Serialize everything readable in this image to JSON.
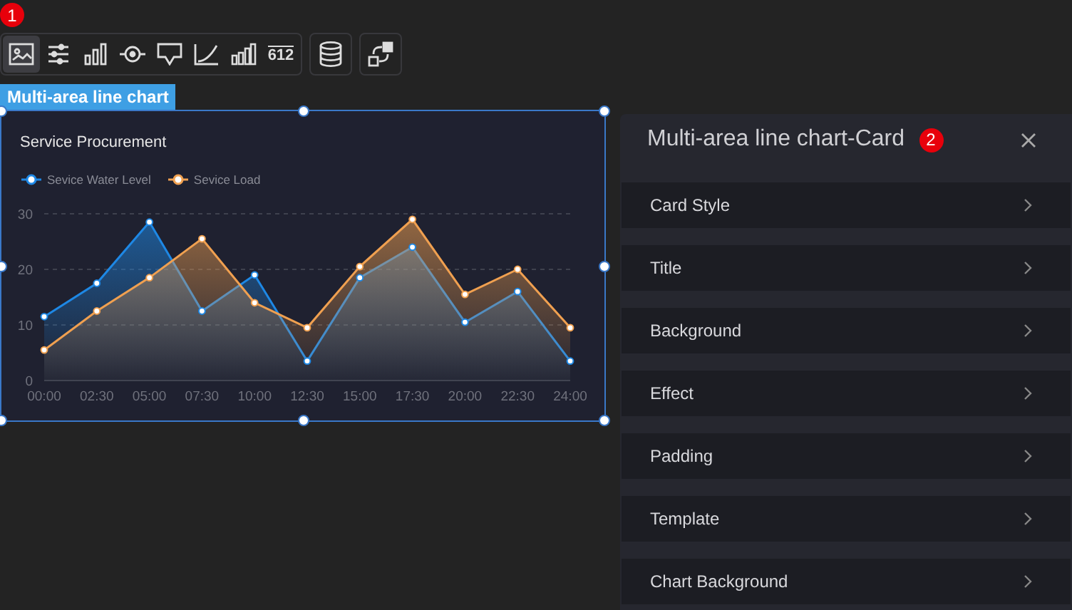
{
  "markers": [
    "1",
    "2"
  ],
  "toolbar": {
    "groups": [
      {
        "buttons": [
          {
            "kind": "image",
            "selected": true
          },
          {
            "kind": "sliders",
            "selected": false
          },
          {
            "kind": "bars",
            "selected": false
          },
          {
            "kind": "target",
            "selected": false
          },
          {
            "kind": "message",
            "selected": false
          },
          {
            "kind": "line",
            "selected": false
          },
          {
            "kind": "columns",
            "selected": false
          },
          {
            "kind": "number",
            "label": "612",
            "selected": false
          }
        ]
      },
      {
        "buttons": [
          {
            "kind": "database",
            "selected": false
          }
        ]
      },
      {
        "buttons": [
          {
            "kind": "swap",
            "selected": false
          }
        ]
      }
    ]
  },
  "component_label": "Multi-area line chart",
  "chart": {
    "chart_data": {
      "type": "area",
      "title": "Service Procurement",
      "categories": [
        "00:00",
        "02:30",
        "05:00",
        "07:30",
        "10:00",
        "12:30",
        "15:00",
        "17:30",
        "20:00",
        "22:30",
        "24:00"
      ],
      "series": [
        {
          "name": "Sevice Water Level",
          "color": "#1e88e5",
          "values": [
            11.5,
            17.5,
            28.5,
            12.5,
            19,
            3.5,
            18.5,
            24,
            10.5,
            16,
            3.5
          ]
        },
        {
          "name": "Sevice Load",
          "color": "#f0a050",
          "values": [
            5.5,
            12.5,
            18.5,
            25.5,
            14,
            9.5,
            20.5,
            29,
            15.5,
            20,
            9.5
          ]
        }
      ],
      "ylim": [
        0,
        30
      ],
      "yticks": [
        0,
        10,
        20,
        30
      ]
    }
  },
  "panel": {
    "title": "Multi-area line chart-Card",
    "items": [
      "Card Style",
      "Title",
      "Background",
      "Effect",
      "Padding",
      "Template",
      "Chart Background"
    ]
  }
}
